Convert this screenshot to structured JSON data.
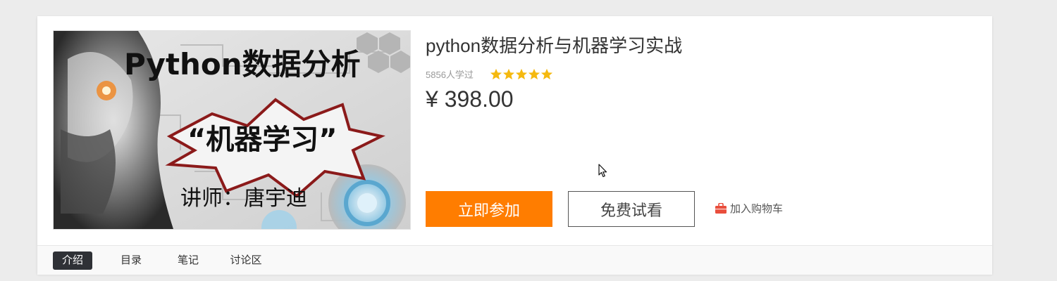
{
  "course": {
    "cover": {
      "title_text": "Python数据分析",
      "subtitle_text": "“机器学习”",
      "instructor_text": "讲师：唐宇迪"
    },
    "title": "python数据分析与机器学习实战",
    "learners": "5856人学过",
    "rating": 5,
    "rating_max": 5,
    "price": "¥ 398.00",
    "actions": {
      "join_label": "立即参加",
      "trial_label": "免费试看",
      "cart_label": "加入购物车"
    }
  },
  "tabs": [
    {
      "label": "介绍",
      "active": true
    },
    {
      "label": "目录",
      "active": false
    },
    {
      "label": "笔记",
      "active": false
    },
    {
      "label": "讨论区",
      "active": false
    }
  ],
  "colors": {
    "primary_button": "#ff7d00",
    "star": "#f5b90f",
    "active_tab": "#2f3136",
    "cart_icon": "#e94e3c"
  },
  "icons": {
    "cart": "shopping-bag-icon",
    "star": "star-icon",
    "cursor": "mouse-pointer-icon"
  }
}
